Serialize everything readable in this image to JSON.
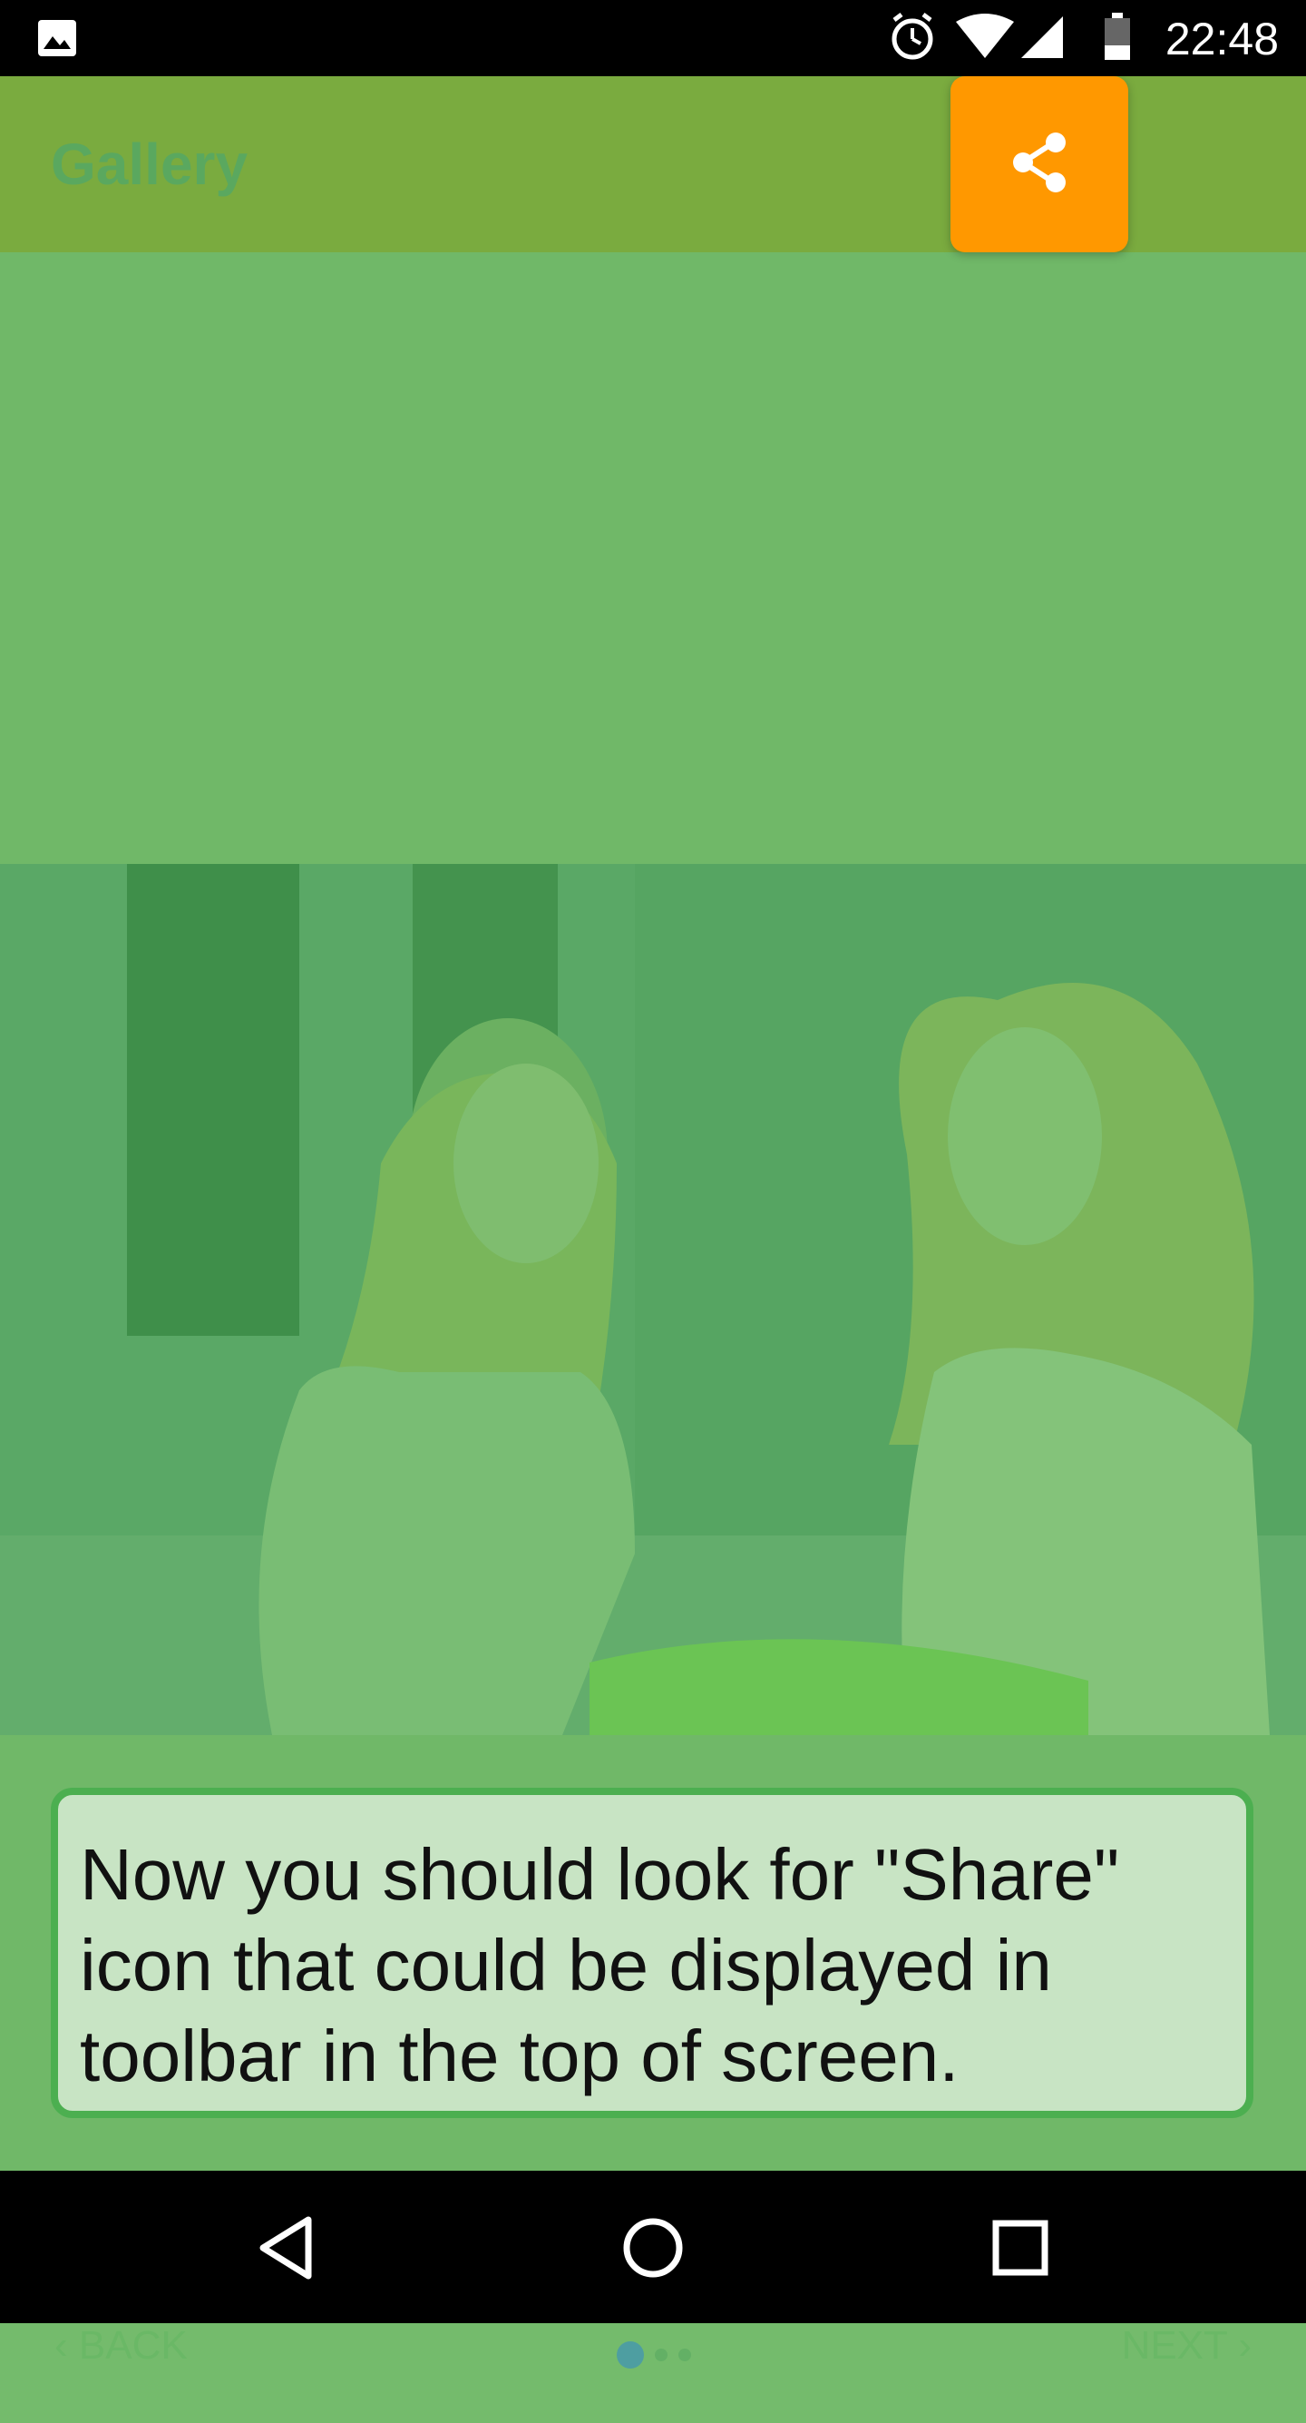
{
  "status_bar": {
    "time": "22:48",
    "icons": [
      "gallery-icon",
      "alarm-icon",
      "wifi-icon",
      "signal-icon",
      "battery-icon"
    ]
  },
  "app_bar": {
    "title": "Gallery",
    "share_icon": "share-icon"
  },
  "tooltip": {
    "text": "Now you should look for \"Share\" icon that could be displayed in toolbar in the top of screen."
  },
  "tutorial_nav": {
    "back_label": "‹ BACK",
    "next_label": "NEXT ›"
  },
  "system_nav": {
    "icons": [
      "back-icon",
      "home-icon",
      "recents-icon"
    ]
  },
  "colors": {
    "app_bar": "#7aab3f",
    "overlay": "#70b868",
    "share_button": "#ff9800",
    "tooltip_border": "#4caf50",
    "tooltip_bg": "#c8e4c4"
  }
}
